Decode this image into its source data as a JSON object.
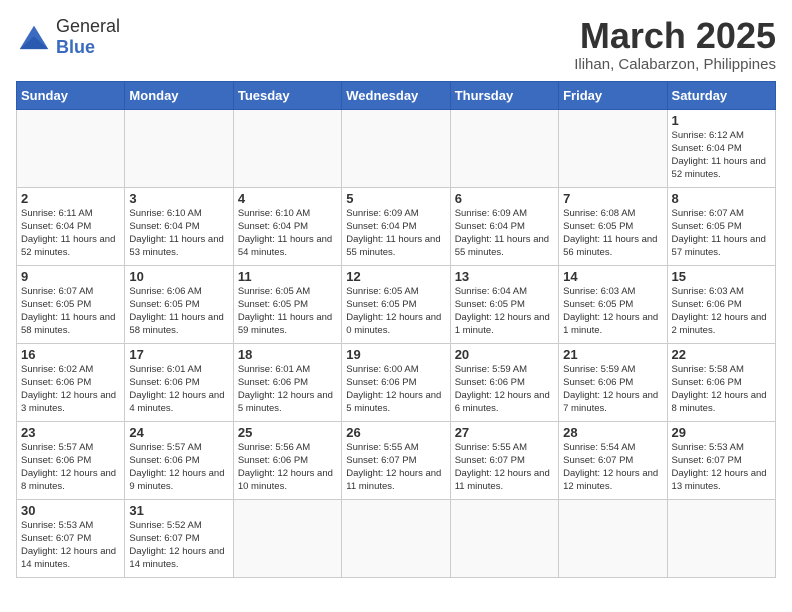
{
  "header": {
    "logo_general": "General",
    "logo_blue": "Blue",
    "month_year": "March 2025",
    "location": "Ilihan, Calabarzon, Philippines"
  },
  "weekdays": [
    "Sunday",
    "Monday",
    "Tuesday",
    "Wednesday",
    "Thursday",
    "Friday",
    "Saturday"
  ],
  "weeks": [
    [
      {
        "day": null
      },
      {
        "day": null
      },
      {
        "day": null
      },
      {
        "day": null
      },
      {
        "day": null
      },
      {
        "day": null
      },
      {
        "day": 1,
        "sunrise": "6:12 AM",
        "sunset": "6:04 PM",
        "daylight": "11 hours and 52 minutes."
      }
    ],
    [
      {
        "day": 2,
        "sunrise": "6:11 AM",
        "sunset": "6:04 PM",
        "daylight": "11 hours and 52 minutes."
      },
      {
        "day": 3,
        "sunrise": "6:10 AM",
        "sunset": "6:04 PM",
        "daylight": "11 hours and 53 minutes."
      },
      {
        "day": 4,
        "sunrise": "6:10 AM",
        "sunset": "6:04 PM",
        "daylight": "11 hours and 54 minutes."
      },
      {
        "day": 5,
        "sunrise": "6:09 AM",
        "sunset": "6:04 PM",
        "daylight": "11 hours and 55 minutes."
      },
      {
        "day": 6,
        "sunrise": "6:09 AM",
        "sunset": "6:04 PM",
        "daylight": "11 hours and 55 minutes."
      },
      {
        "day": 7,
        "sunrise": "6:08 AM",
        "sunset": "6:05 PM",
        "daylight": "11 hours and 56 minutes."
      },
      {
        "day": 8,
        "sunrise": "6:07 AM",
        "sunset": "6:05 PM",
        "daylight": "11 hours and 57 minutes."
      }
    ],
    [
      {
        "day": 9,
        "sunrise": "6:07 AM",
        "sunset": "6:05 PM",
        "daylight": "11 hours and 58 minutes."
      },
      {
        "day": 10,
        "sunrise": "6:06 AM",
        "sunset": "6:05 PM",
        "daylight": "11 hours and 58 minutes."
      },
      {
        "day": 11,
        "sunrise": "6:05 AM",
        "sunset": "6:05 PM",
        "daylight": "11 hours and 59 minutes."
      },
      {
        "day": 12,
        "sunrise": "6:05 AM",
        "sunset": "6:05 PM",
        "daylight": "12 hours and 0 minutes."
      },
      {
        "day": 13,
        "sunrise": "6:04 AM",
        "sunset": "6:05 PM",
        "daylight": "12 hours and 1 minute."
      },
      {
        "day": 14,
        "sunrise": "6:03 AM",
        "sunset": "6:05 PM",
        "daylight": "12 hours and 1 minute."
      },
      {
        "day": 15,
        "sunrise": "6:03 AM",
        "sunset": "6:06 PM",
        "daylight": "12 hours and 2 minutes."
      }
    ],
    [
      {
        "day": 16,
        "sunrise": "6:02 AM",
        "sunset": "6:06 PM",
        "daylight": "12 hours and 3 minutes."
      },
      {
        "day": 17,
        "sunrise": "6:01 AM",
        "sunset": "6:06 PM",
        "daylight": "12 hours and 4 minutes."
      },
      {
        "day": 18,
        "sunrise": "6:01 AM",
        "sunset": "6:06 PM",
        "daylight": "12 hours and 5 minutes."
      },
      {
        "day": 19,
        "sunrise": "6:00 AM",
        "sunset": "6:06 PM",
        "daylight": "12 hours and 5 minutes."
      },
      {
        "day": 20,
        "sunrise": "5:59 AM",
        "sunset": "6:06 PM",
        "daylight": "12 hours and 6 minutes."
      },
      {
        "day": 21,
        "sunrise": "5:59 AM",
        "sunset": "6:06 PM",
        "daylight": "12 hours and 7 minutes."
      },
      {
        "day": 22,
        "sunrise": "5:58 AM",
        "sunset": "6:06 PM",
        "daylight": "12 hours and 8 minutes."
      }
    ],
    [
      {
        "day": 23,
        "sunrise": "5:57 AM",
        "sunset": "6:06 PM",
        "daylight": "12 hours and 8 minutes."
      },
      {
        "day": 24,
        "sunrise": "5:57 AM",
        "sunset": "6:06 PM",
        "daylight": "12 hours and 9 minutes."
      },
      {
        "day": 25,
        "sunrise": "5:56 AM",
        "sunset": "6:06 PM",
        "daylight": "12 hours and 10 minutes."
      },
      {
        "day": 26,
        "sunrise": "5:55 AM",
        "sunset": "6:07 PM",
        "daylight": "12 hours and 11 minutes."
      },
      {
        "day": 27,
        "sunrise": "5:55 AM",
        "sunset": "6:07 PM",
        "daylight": "12 hours and 11 minutes."
      },
      {
        "day": 28,
        "sunrise": "5:54 AM",
        "sunset": "6:07 PM",
        "daylight": "12 hours and 12 minutes."
      },
      {
        "day": 29,
        "sunrise": "5:53 AM",
        "sunset": "6:07 PM",
        "daylight": "12 hours and 13 minutes."
      }
    ],
    [
      {
        "day": 30,
        "sunrise": "5:53 AM",
        "sunset": "6:07 PM",
        "daylight": "12 hours and 14 minutes."
      },
      {
        "day": 31,
        "sunrise": "5:52 AM",
        "sunset": "6:07 PM",
        "daylight": "12 hours and 14 minutes."
      },
      {
        "day": null
      },
      {
        "day": null
      },
      {
        "day": null
      },
      {
        "day": null
      },
      {
        "day": null
      }
    ]
  ]
}
